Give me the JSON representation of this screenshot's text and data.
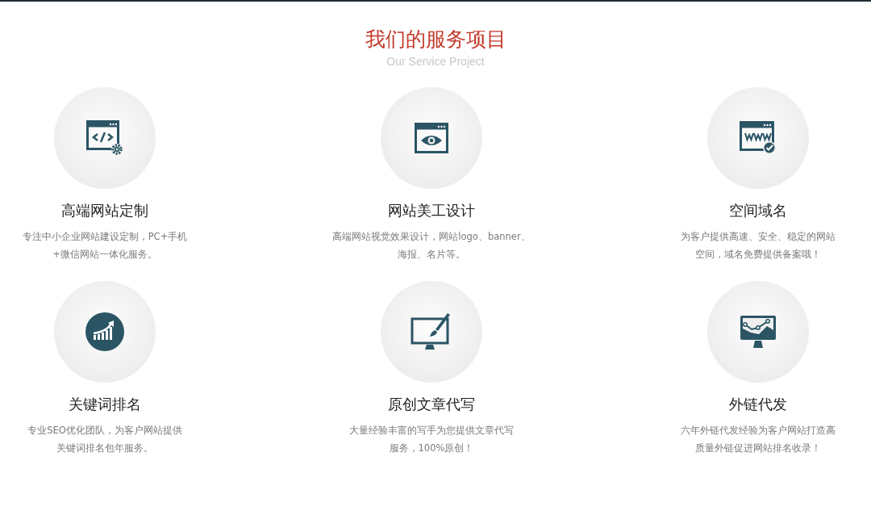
{
  "header": {
    "title": "我们的服务项目",
    "subtitle": "Our Service Project"
  },
  "services": [
    {
      "kind": "code-window",
      "title": "高端网站定制",
      "description": [
        "专注中小企业网站建设定制，PC+手机",
        "+微信网站一体化服务。"
      ]
    },
    {
      "kind": "eye-window",
      "title": "网站美工设计",
      "description": [
        "高端网站视觉效果设计，网站logo、banner、",
        "海报、名片等。"
      ]
    },
    {
      "kind": "www-window",
      "title": "空间域名",
      "description": [
        "为客户提供高速、安全、稳定的网站",
        "空间，域名免费提供备案哦！"
      ]
    },
    {
      "kind": "growth-chart",
      "title": "关键词排名",
      "description": [
        "专业SEO优化团队，为客户网站提供",
        "关键词排名包年服务。"
      ]
    },
    {
      "kind": "monitor-brush",
      "title": "原创文章代写",
      "description": [
        "大量经验丰富的写手为您提供文章代写",
        "服务，100%原创！"
      ]
    },
    {
      "kind": "monitor-chart",
      "title": "外链代发",
      "description": [
        "六年外链代发经验为客户网站打造高",
        "质量外链促进网站排名收录！"
      ]
    }
  ]
}
